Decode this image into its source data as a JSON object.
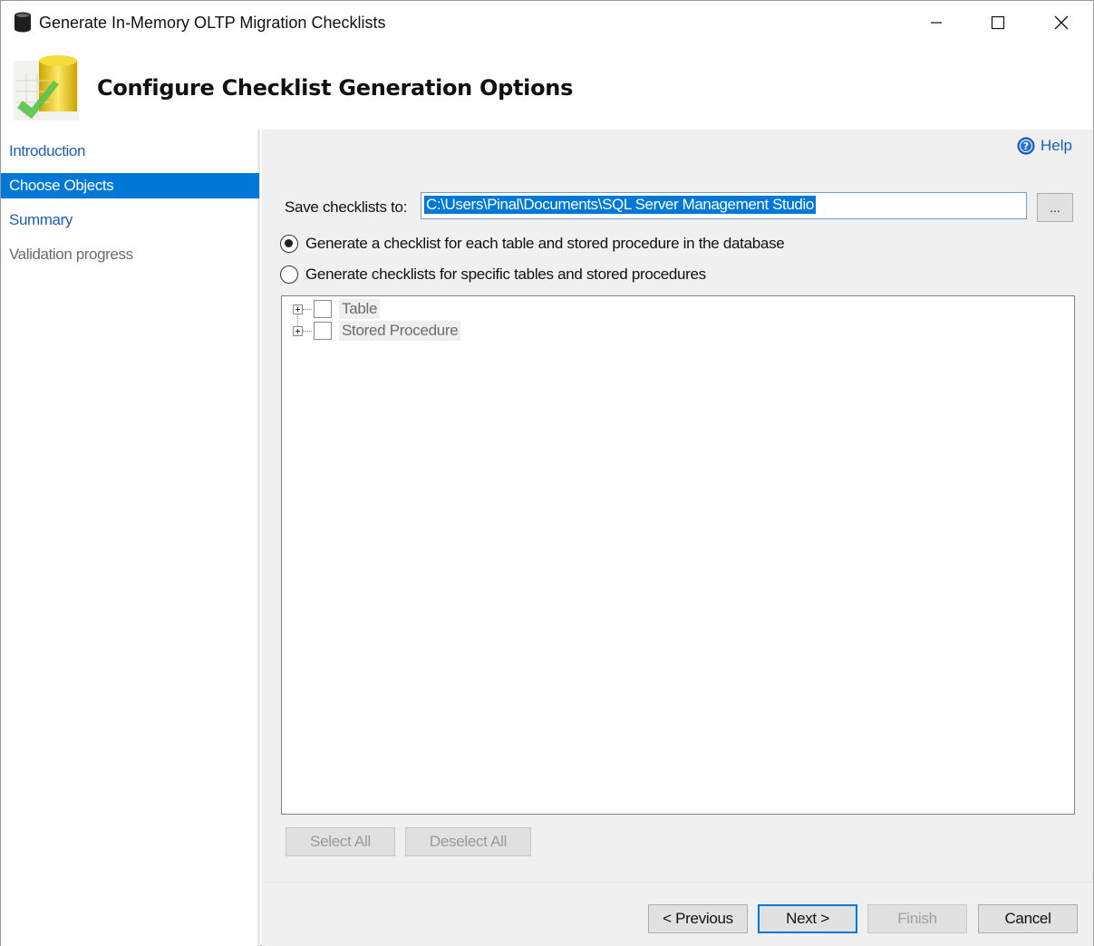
{
  "window": {
    "title": "Generate In-Memory OLTP Migration Checklists"
  },
  "header": {
    "title": "Configure Checklist Generation Options"
  },
  "nav": {
    "items": [
      {
        "label": "Introduction",
        "state": "link"
      },
      {
        "label": "Choose Objects",
        "state": "selected"
      },
      {
        "label": "Summary",
        "state": "link"
      },
      {
        "label": "Validation progress",
        "state": "disabled"
      }
    ]
  },
  "help": {
    "label": "Help"
  },
  "save": {
    "label": "Save checklists to:",
    "path": "C:\\Users\\Pinal\\Documents\\SQL Server Management Studio",
    "browse_label": "..."
  },
  "options": {
    "all_label": "Generate a checklist for each table and stored procedure in the database",
    "all_selected": true,
    "specific_label": "Generate checklists for specific tables and stored procedures",
    "specific_selected": false
  },
  "tree": {
    "items": [
      {
        "label": "Table",
        "checked": false
      },
      {
        "label": "Stored Procedure",
        "checked": false
      }
    ]
  },
  "selection_buttons": {
    "select_all": "Select All",
    "deselect_all": "Deselect All"
  },
  "wizard_buttons": {
    "previous": "< Previous",
    "next": "Next >",
    "finish": "Finish",
    "cancel": "Cancel"
  },
  "colors": {
    "accent": "#0078d7",
    "link": "#1b5fbd",
    "panel_bg": "#f0f0f0"
  },
  "icons": {
    "title": "database-icon",
    "header": "checklist-wizard-graphic",
    "help": "help-circle-icon"
  }
}
